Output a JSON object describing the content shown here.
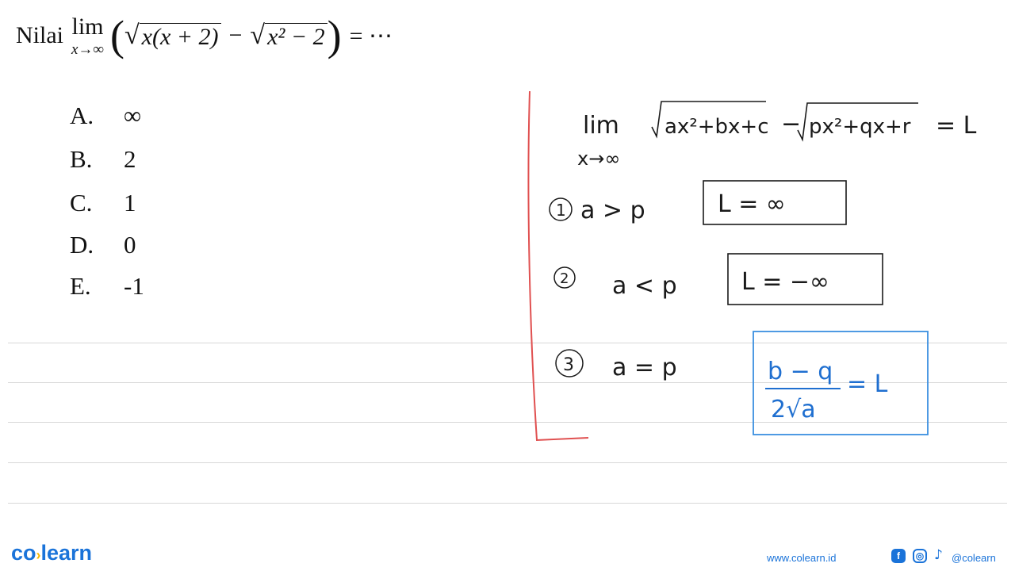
{
  "question": {
    "prefix": "Nilai",
    "lim": "lim",
    "lim_sub": "x→∞",
    "term1": "x(x + 2)",
    "minus": "−",
    "term2": "x² − 2",
    "equals": "= ⋯"
  },
  "options": [
    {
      "letter": "A.",
      "value": "∞"
    },
    {
      "letter": "B.",
      "value": "2"
    },
    {
      "letter": "C.",
      "value": "1"
    },
    {
      "letter": "D.",
      "value": "0"
    },
    {
      "letter": "E.",
      "value": "-1"
    }
  ],
  "notes": {
    "lim": "lim",
    "lim_sub": "x→∞",
    "expr1": "ax²+bx+c",
    "minus": "−",
    "expr2": "px²+qx+r",
    "equals_L": "= L",
    "case1_num": "1",
    "case1_cond": "a > p",
    "case1_result": "L = ∞",
    "case2_num": "2",
    "case2_cond": "a < p",
    "case2_result": "L = −∞",
    "case3_num": "3",
    "case3_cond": "a = p",
    "case3_num_expr": "b − q",
    "case3_den": "2√a",
    "case3_eq": "= L"
  },
  "colors": {
    "margin_line": "#e05050",
    "box3": "#3a8fe0",
    "brand": "#1a73d9"
  },
  "footer": {
    "logo_left": "co",
    "logo_right": "learn",
    "website": "www.colearn.id",
    "handle": "@colearn",
    "icons": [
      "facebook-icon",
      "instagram-icon",
      "tiktok-icon"
    ]
  }
}
